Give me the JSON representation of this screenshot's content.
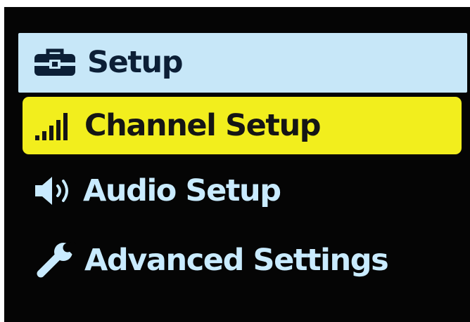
{
  "menu": {
    "title": "Setup",
    "title_icon": "toolbox-icon",
    "items": [
      {
        "label": "Channel Setup",
        "icon": "signal-strength-icon",
        "selected": true
      },
      {
        "label": "Audio Setup",
        "icon": "speaker-icon",
        "selected": false
      },
      {
        "label": "Advanced Settings",
        "icon": "wrench-icon",
        "selected": false
      }
    ]
  },
  "colors": {
    "screen_background": "#050505",
    "header_background": "#c7e7f8",
    "selected_background": "#f2ee1d",
    "text_light": "#c9ebff",
    "text_dark": "#151515"
  }
}
